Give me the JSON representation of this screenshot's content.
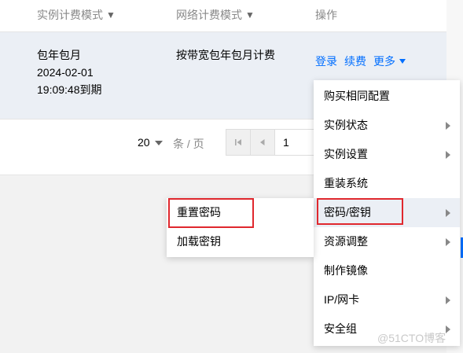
{
  "table": {
    "headers": {
      "billing_mode": "实例计费模式",
      "network_billing_mode": "网络计费模式",
      "actions": "操作"
    },
    "row": {
      "billing_mode": "包年包月",
      "date": "2024-02-01",
      "expire": "19:09:48到期",
      "network_billing": "按带宽包年包月计费",
      "actions": {
        "login": "登录",
        "renew": "续费",
        "more": "更多"
      }
    }
  },
  "pagination": {
    "page_size": "20",
    "unit": "条 / 页",
    "current_page": "1"
  },
  "menu": {
    "items": [
      {
        "label": "购买相同配置",
        "has_submenu": false
      },
      {
        "label": "实例状态",
        "has_submenu": true
      },
      {
        "label": "实例设置",
        "has_submenu": true
      },
      {
        "label": "重装系统",
        "has_submenu": false
      },
      {
        "label": "密码/密钥",
        "has_submenu": true,
        "active": true
      },
      {
        "label": "资源调整",
        "has_submenu": true
      },
      {
        "label": "制作镜像",
        "has_submenu": false
      },
      {
        "label": "IP/网卡",
        "has_submenu": true
      },
      {
        "label": "安全组",
        "has_submenu": true
      }
    ]
  },
  "submenu": {
    "items": [
      {
        "label": "重置密码"
      },
      {
        "label": "加载密钥"
      }
    ]
  },
  "watermark": "@51CTO博客",
  "colors": {
    "accent": "#006eff",
    "highlight": "#e0282e",
    "row_bg": "#ebeff5"
  }
}
